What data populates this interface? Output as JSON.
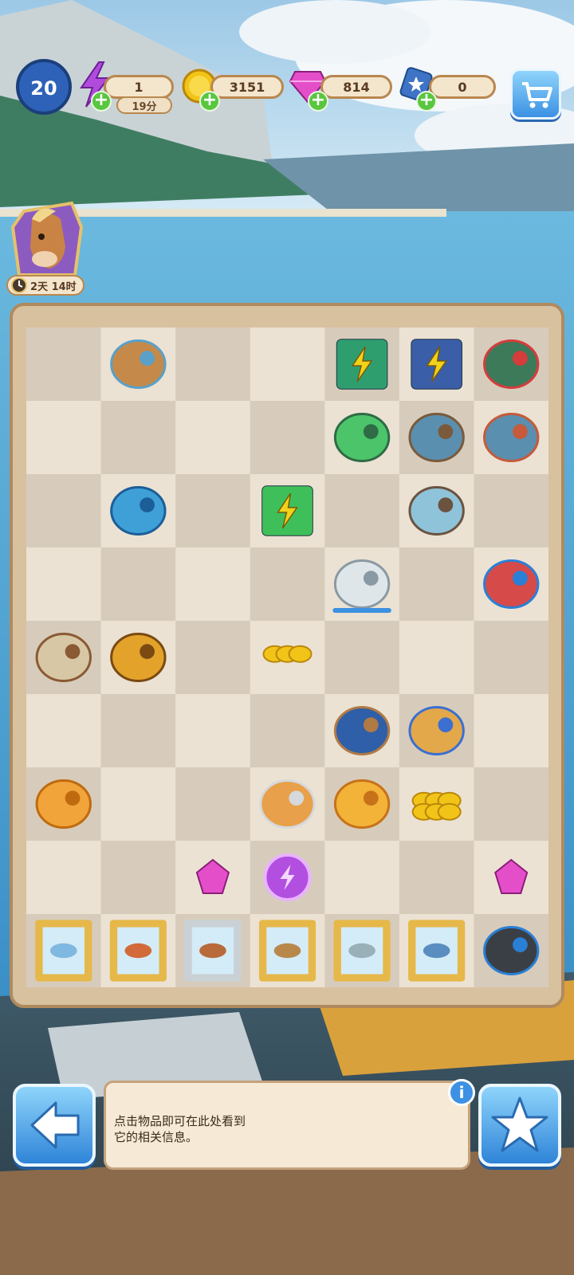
{
  "hud": {
    "level": "20",
    "energy": "1",
    "energy_timer": "19分",
    "coins": "3151",
    "gems": "814",
    "stars": "0"
  },
  "event": {
    "timer": "2天 14时"
  },
  "info": {
    "line1": "点击物品即可在此处看到",
    "line2": "它的相关信息。"
  },
  "colors": {
    "sea": "#4aa3d8",
    "board_light": "#ebe2d3",
    "board_dark": "#d7ccbb",
    "frame": "#b08a5e",
    "accent_blue": "#3c91e3",
    "plus_green": "#59c63f"
  },
  "board_items": [
    {
      "row": 0,
      "col": 1,
      "name": "fishing-stand"
    },
    {
      "row": 0,
      "col": 4,
      "name": "energy-tackle-box"
    },
    {
      "row": 0,
      "col": 5,
      "name": "energy-cabinet"
    },
    {
      "row": 0,
      "col": 6,
      "name": "fishing-net"
    },
    {
      "row": 1,
      "col": 4,
      "name": "fishing-lure"
    },
    {
      "row": 1,
      "col": 5,
      "name": "pond-grass"
    },
    {
      "row": 1,
      "col": 6,
      "name": "pond-rock"
    },
    {
      "row": 2,
      "col": 1,
      "name": "blue-star-shape"
    },
    {
      "row": 2,
      "col": 3,
      "name": "energy-pack"
    },
    {
      "row": 2,
      "col": 5,
      "name": "small-pond"
    },
    {
      "row": 3,
      "col": 4,
      "name": "glass-display-case"
    },
    {
      "row": 3,
      "col": 6,
      "name": "thread-spools"
    },
    {
      "row": 4,
      "col": 0,
      "name": "brush-and-comb"
    },
    {
      "row": 4,
      "col": 1,
      "name": "raincoat"
    },
    {
      "row": 4,
      "col": 3,
      "name": "coin-pile-small"
    },
    {
      "row": 5,
      "col": 4,
      "name": "grooming-brush"
    },
    {
      "row": 5,
      "col": 5,
      "name": "sponge-with-bow"
    },
    {
      "row": 6,
      "col": 0,
      "name": "feather-duster"
    },
    {
      "row": 6,
      "col": 3,
      "name": "fish-trophy"
    },
    {
      "row": 6,
      "col": 4,
      "name": "fishing-hat"
    },
    {
      "row": 6,
      "col": 5,
      "name": "coin-pile-large"
    },
    {
      "row": 7,
      "col": 2,
      "name": "pink-gem"
    },
    {
      "row": 7,
      "col": 3,
      "name": "energy-orb"
    },
    {
      "row": 7,
      "col": 6,
      "name": "pink-gems"
    }
  ],
  "bottom_row": [
    "eel-picture",
    "red-fish-picture",
    "scorpionfish-picture",
    "flounder-picture",
    "pike-picture",
    "swordfish-picture",
    "camera"
  ]
}
